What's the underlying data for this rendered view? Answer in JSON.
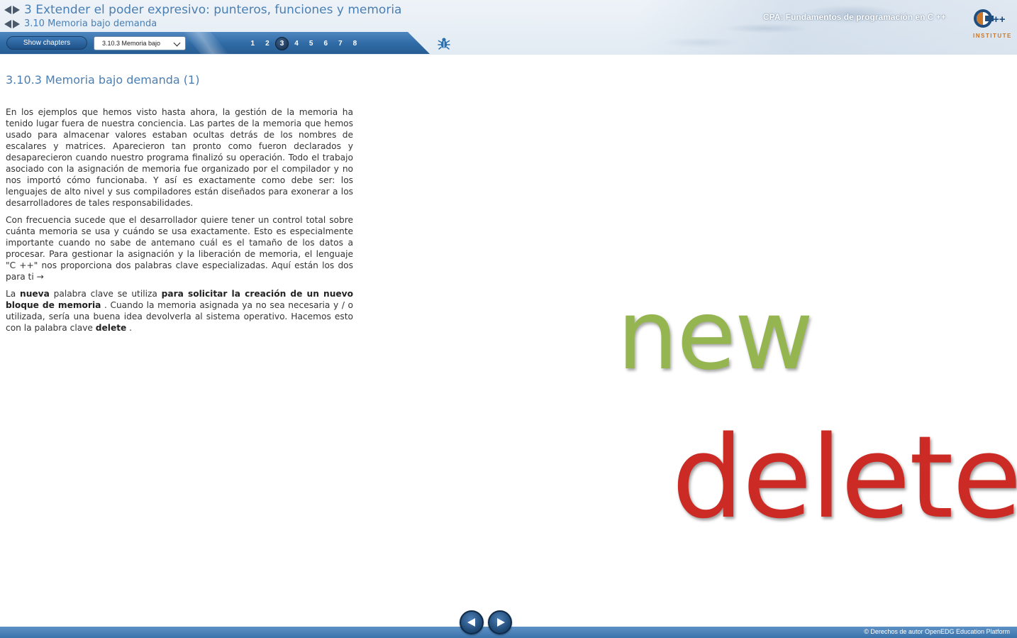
{
  "header": {
    "chapter_title": "3 Extender el poder expresivo: punteros, funciones y memoria",
    "section_title": "3.10 Memoria bajo demanda",
    "brand_title": "CPA: Fundamentos de programación en C ++",
    "logo_text": "INSTITUTE",
    "logo_lettering": "C++"
  },
  "toolbar": {
    "show_chapters_label": "Show chapters",
    "section_select_value": "3.10.3 Memoria bajo",
    "pages": [
      "1",
      "2",
      "3",
      "4",
      "5",
      "6",
      "7",
      "8"
    ],
    "active_page": "3",
    "bug_icon": "bug-icon"
  },
  "content": {
    "heading": "3.10.3 Memoria bajo demanda (1)",
    "p1": "En los ejemplos que hemos visto hasta ahora, la gestión de la memoria ha tenido lugar fuera de nuestra conciencia. Las partes de la memoria que hemos usado para almacenar valores estaban ocultas detrás de los nombres de escalares y matrices. Aparecieron tan pronto como fueron declarados y desaparecieron cuando nuestro programa finalizó su operación. Todo el trabajo asociado con la asignación de memoria fue organizado por el compilador y no nos importó cómo funcionaba. Y así es exactamente como debe ser: los lenguajes de alto nivel y sus compiladores están diseñados para exonerar a los desarrolladores de tales responsabilidades.",
    "p2": "Con frecuencia sucede que el desarrollador quiere tener un control total sobre cuánta memoria se usa y cuándo se usa exactamente. Esto es especialmente importante cuando no sabe de antemano cuál es el tamaño de los datos a procesar. Para gestionar la asignación y la liberación de memoria, el lenguaje \"C ++\" nos proporciona dos palabras clave especializadas. Aquí están los dos para ti →",
    "p3": {
      "t1": "La ",
      "b1": "nueva",
      "t2": " palabra clave se utiliza ",
      "b2": "para solicitar la creación de un nuevo bloque de memoria",
      "t3": " . Cuando la memoria asignada ya no sea necesaria y / o utilizada, sería una buena idea devolverla al sistema operativo. Hacemos esto con la palabra clave ",
      "b3": "delete",
      "t4": " ."
    },
    "word_new": "new",
    "word_delete": "delete",
    "colors": {
      "new": "#94b54f",
      "delete": "#cc2a24",
      "heading": "#4a7fb3"
    }
  },
  "footer": {
    "copyright": "© Derechos de autor OpenEDG Education Platform",
    "prev_icon": "prev-arrow-icon",
    "next_icon": "next-arrow-icon"
  }
}
